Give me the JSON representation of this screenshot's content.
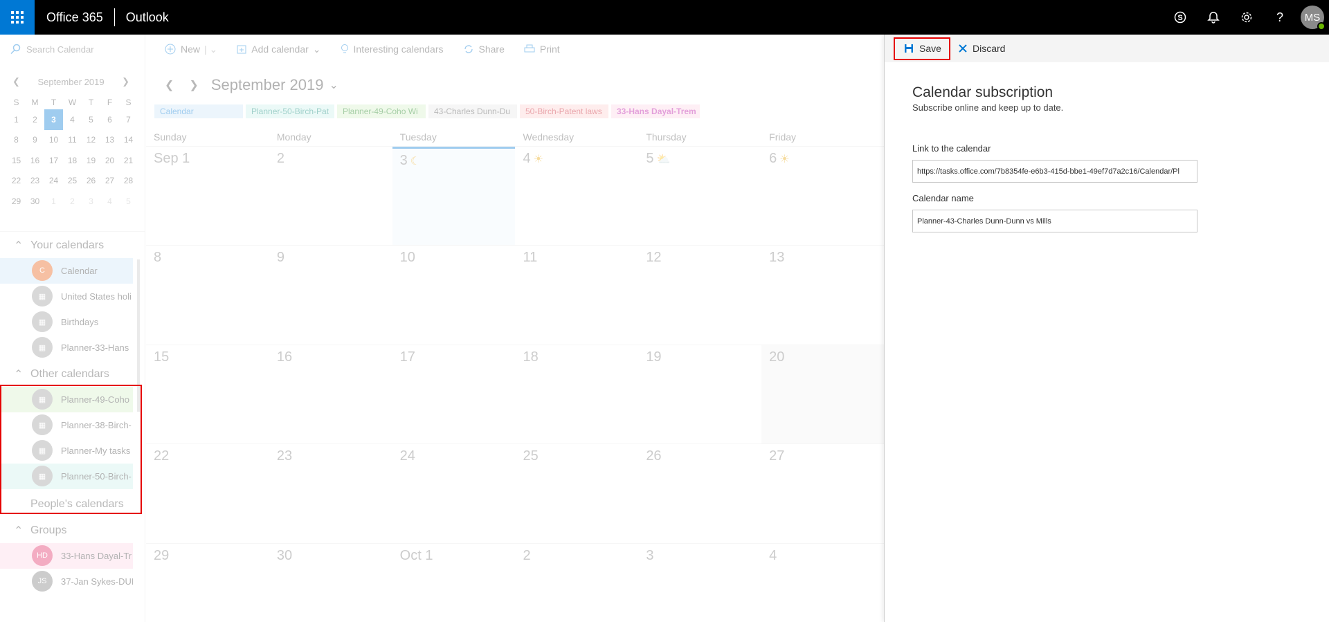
{
  "topbar": {
    "brand": "Office 365",
    "app": "Outlook",
    "avatar_initials": "MS",
    "icons": [
      "skype-icon",
      "bell-icon",
      "gear-icon",
      "help-icon"
    ]
  },
  "search": {
    "placeholder": "Search Calendar"
  },
  "mini_calendar": {
    "title": "September 2019",
    "dow": [
      "S",
      "M",
      "T",
      "W",
      "T",
      "F",
      "S"
    ],
    "weeks": [
      [
        "1",
        "2",
        "3",
        "4",
        "5",
        "6",
        "7"
      ],
      [
        "8",
        "9",
        "10",
        "11",
        "12",
        "13",
        "14"
      ],
      [
        "15",
        "16",
        "17",
        "18",
        "19",
        "20",
        "21"
      ],
      [
        "22",
        "23",
        "24",
        "25",
        "26",
        "27",
        "28"
      ],
      [
        "29",
        "30",
        "1",
        "2",
        "3",
        "4",
        "5"
      ]
    ],
    "today": "3"
  },
  "your_calendars": {
    "label": "Your calendars",
    "items": [
      {
        "badge": "C",
        "label": "Calendar",
        "color": "#e8590c"
      },
      {
        "badge": "",
        "label": "United States holi",
        "color": "#999999"
      },
      {
        "badge": "",
        "label": "Birthdays",
        "color": "#999999"
      },
      {
        "badge": "",
        "label": "Planner-33-Hans",
        "color": "#999999"
      }
    ]
  },
  "other_calendars": {
    "label": "Other calendars",
    "items": [
      {
        "label": "Planner-49-Coho",
        "bg": "#d4f0c8"
      },
      {
        "label": "Planner-38-Birch-",
        "bg": "#ffffff"
      },
      {
        "label": "Planner-My tasks",
        "bg": "#ffffff"
      },
      {
        "label": "Planner-50-Birch-",
        "bg": "#c9f0ea"
      }
    ]
  },
  "peoples_calendars": {
    "label": "People's calendars"
  },
  "groups": {
    "label": "Groups",
    "items": [
      {
        "badge": "HD",
        "label": "33-Hans Dayal-Tr",
        "color": "#e0245e",
        "bg": "#fbd5e5"
      },
      {
        "badge": "JS",
        "label": "37-Jan Sykes-DUI",
        "color": "#777777",
        "bg": "#ffffff"
      }
    ]
  },
  "toolbar": {
    "new": "New",
    "add_calendar": "Add calendar",
    "interesting": "Interesting calendars",
    "share": "Share",
    "print": "Print"
  },
  "calendar": {
    "month_title": "September 2019",
    "chips": [
      {
        "label": "Calendar",
        "bg": "#cce4f6",
        "color": "#0078d4"
      },
      {
        "label": "Planner-50-Birch-Pat",
        "bg": "#c9f0ea",
        "color": "#008272"
      },
      {
        "label": "Planner-49-Coho Wi",
        "bg": "#d4f0c8",
        "color": "#107c10"
      },
      {
        "label": "43-Charles Dunn-Du",
        "bg": "#e6e6e6",
        "color": "#444444"
      },
      {
        "label": "50-Birch-Patent laws",
        "bg": "#fbd0d0",
        "color": "#c50f1f"
      },
      {
        "label": "33-Hans Dayal-Trem",
        "bg": "#fbd5e5",
        "color": "#b4009e"
      }
    ],
    "dow": [
      "Sunday",
      "Monday",
      "Tuesday",
      "Wednesday",
      "Thursday",
      "Friday"
    ],
    "weeks": [
      [
        "Sep 1",
        "2",
        "3",
        "4",
        "5",
        "6"
      ],
      [
        "8",
        "9",
        "10",
        "11",
        "12",
        "13"
      ],
      [
        "15",
        "16",
        "17",
        "18",
        "19",
        "20"
      ],
      [
        "22",
        "23",
        "24",
        "25",
        "26",
        "27"
      ],
      [
        "29",
        "30",
        "Oct 1",
        "2",
        "3",
        "4"
      ]
    ]
  },
  "panel": {
    "save": "Save",
    "discard": "Discard",
    "title": "Calendar subscription",
    "subtitle": "Subscribe online and keep up to date.",
    "link_label": "Link to the calendar",
    "link_value": "https://tasks.office.com/7b8354fe-e6b3-415d-bbe1-49ef7d7a2c16/Calendar/Pl",
    "name_label": "Calendar name",
    "name_value": "Planner-43-Charles Dunn-Dunn vs Mills"
  }
}
